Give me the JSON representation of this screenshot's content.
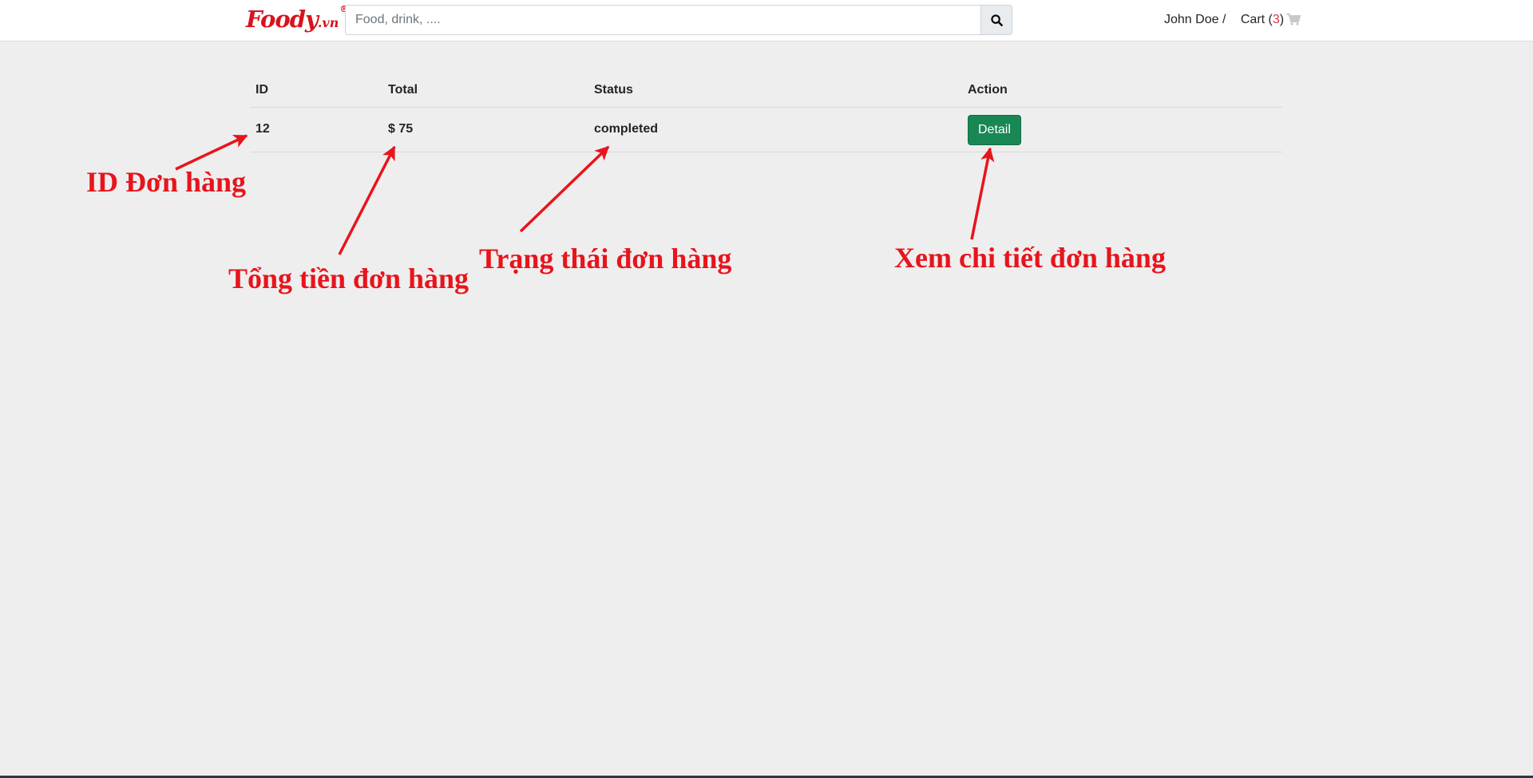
{
  "header": {
    "logo": {
      "text": "Foody",
      "suffix": ".vn",
      "registered": "®"
    },
    "search": {
      "placeholder": "Food, drink, ....",
      "value": ""
    },
    "search_icon": "search-icon",
    "user": {
      "name": "John Doe",
      "separator": "/",
      "cart_label": "Cart",
      "cart_count": "3",
      "cart_icon": "shopping-cart-icon"
    }
  },
  "orders": {
    "columns": [
      "ID",
      "Total",
      "Status",
      "Action"
    ],
    "rows": [
      {
        "id": "12",
        "total": "$ 75",
        "status": "completed",
        "action_label": "Detail"
      }
    ]
  },
  "annotations": {
    "id_label": "ID Đơn hàng",
    "total_label": "Tổng tiền đơn hàng",
    "status_label": "Trạng thái đơn hàng",
    "detail_label": "Xem chi tiết đơn hàng"
  },
  "colors": {
    "brand": "#d7141d",
    "annotation": "#e8141c",
    "button": "#198754",
    "background": "#eeeeee"
  }
}
